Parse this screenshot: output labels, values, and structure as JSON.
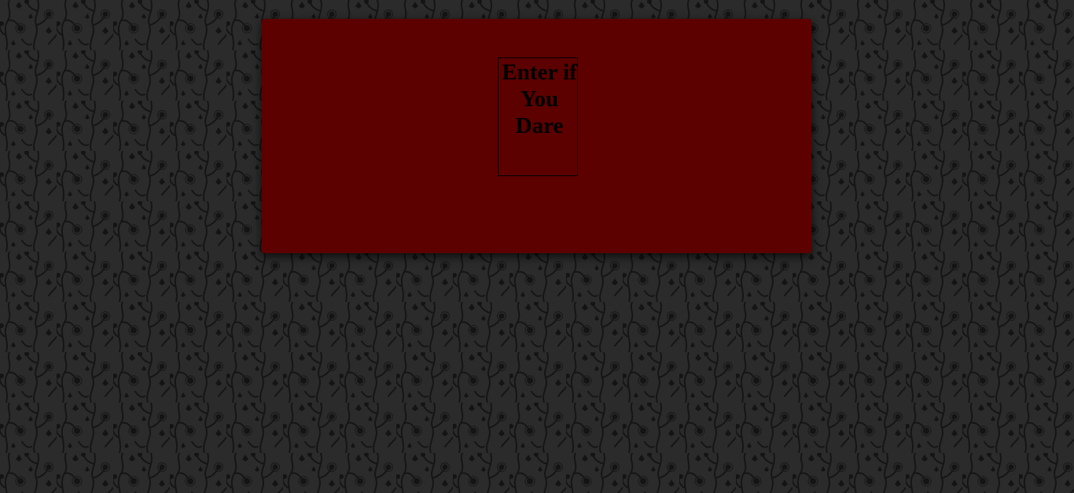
{
  "page": {
    "background_color": "#2a2a2a",
    "pattern_color": "#141414",
    "pattern_icon": "floral-vine-pattern"
  },
  "panel": {
    "background_color": "#5c0000"
  },
  "entry": {
    "label": "Enter if You Dare",
    "text_color": "#000000"
  }
}
